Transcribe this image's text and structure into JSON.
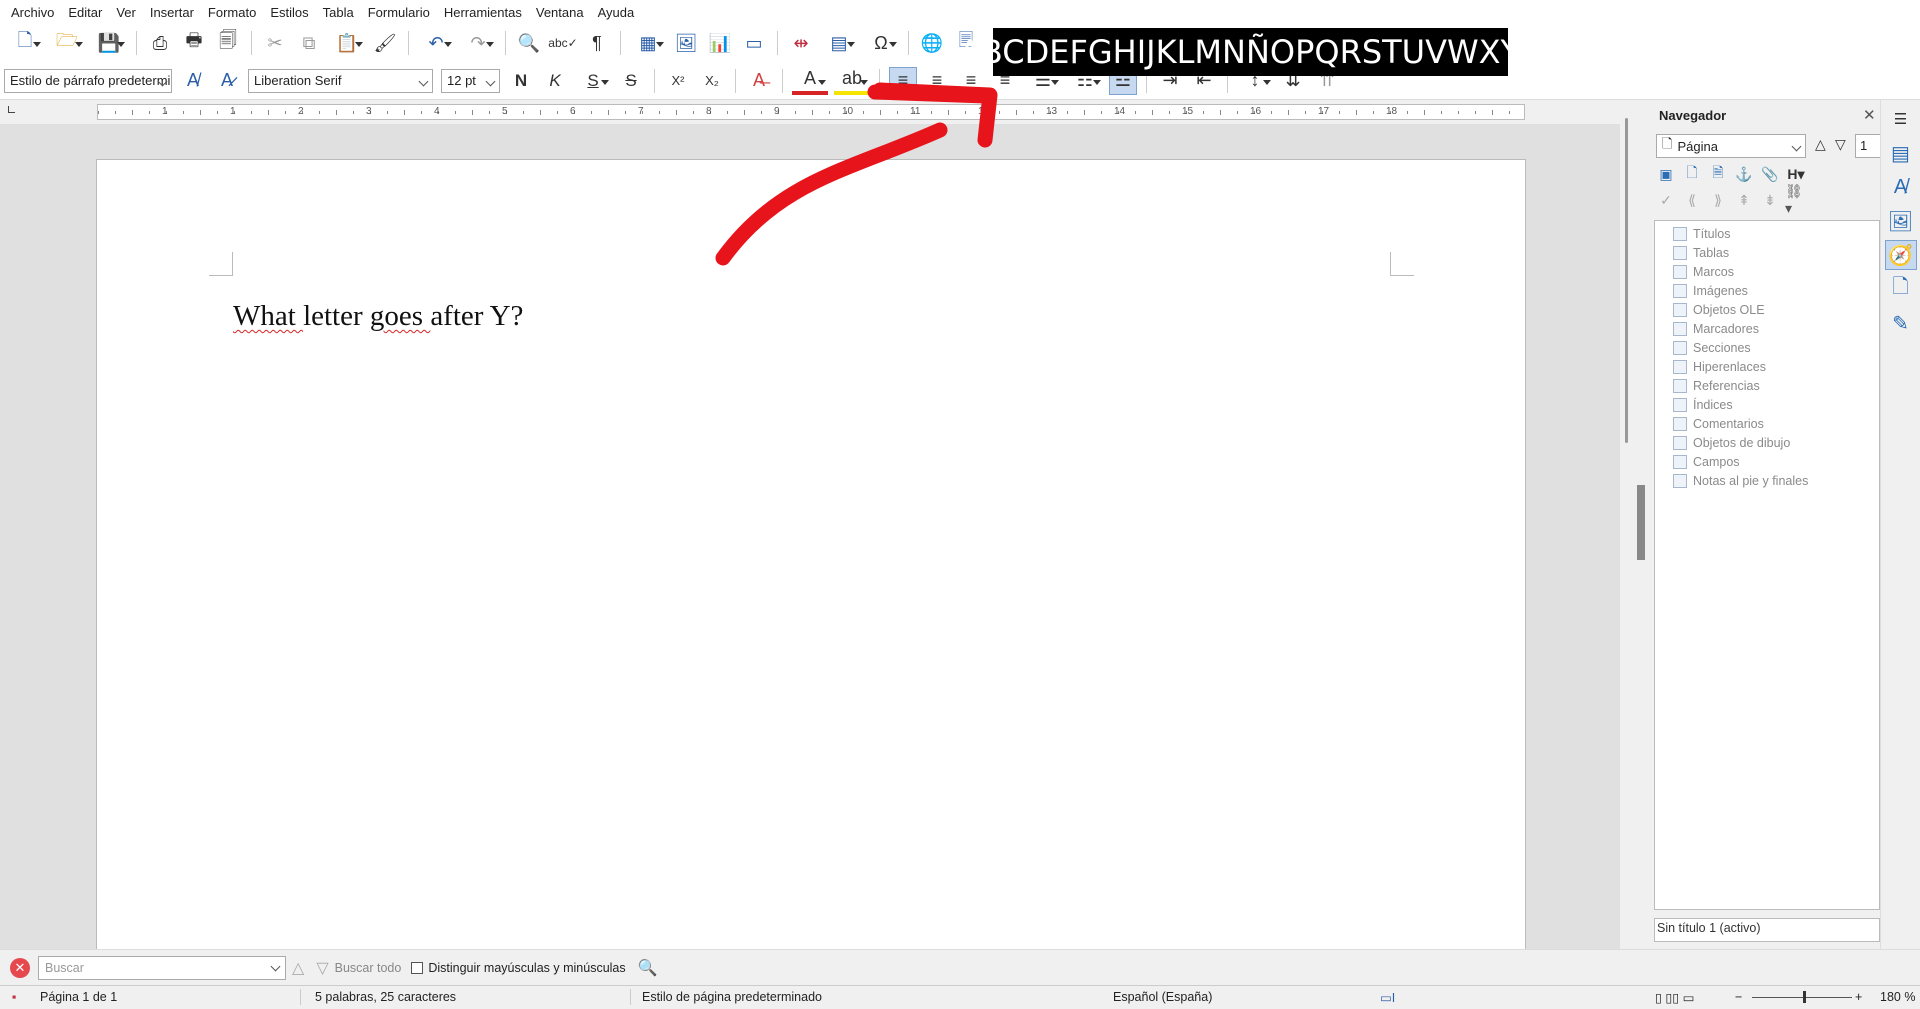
{
  "menu": [
    "Archivo",
    "Editar",
    "Ver",
    "Insertar",
    "Formato",
    "Estilos",
    "Tabla",
    "Formulario",
    "Herramientas",
    "Ventana",
    "Ayuda"
  ],
  "toolbar": {
    "paragraph_style": "Estilo de párrafo predeterminado",
    "font_name": "Liberation Serif",
    "font_size": "12 pt",
    "bold": "N",
    "italic": "K",
    "underline": "S",
    "strike": "S",
    "superscript": "X²",
    "subscript": "X₂"
  },
  "overlay": {
    "alphabet": "ABCDEFGHIJKLMNÑOPQRSTUVWXYZ",
    "arrow_color": "#e8141b"
  },
  "ruler": {
    "numbers": [
      "1",
      "1",
      "2",
      "3",
      "4",
      "5",
      "6",
      "7",
      "8",
      "9",
      "10",
      "11",
      "12",
      "13",
      "14",
      "15",
      "16",
      "17",
      "18"
    ]
  },
  "document": {
    "text": "What letter goes after Y?"
  },
  "navigator": {
    "title": "Navegador",
    "navigate_by": "Página",
    "page_number": "1",
    "items": [
      "Títulos",
      "Tablas",
      "Marcos",
      "Imágenes",
      "Objetos OLE",
      "Marcadores",
      "Secciones",
      "Hiperenlaces",
      "Referencias",
      "Índices",
      "Comentarios",
      "Objetos de dibujo",
      "Campos",
      "Notas al pie y finales"
    ],
    "document": "Sin título 1 (activo)"
  },
  "findbar": {
    "placeholder": "Buscar",
    "find_all": "Buscar todo",
    "match_case": "Distinguir mayúsculas y minúsculas"
  },
  "statusbar": {
    "page": "Página 1 de 1",
    "words": "5 palabras, 25 caracteres",
    "page_style": "Estilo de página predeterminado",
    "language": "Español (España)",
    "zoom": "180 %"
  },
  "colors": {
    "accent": "#2a5ea8",
    "font_color_bar": "#d62424",
    "highlight_bar": "#f5e400"
  }
}
